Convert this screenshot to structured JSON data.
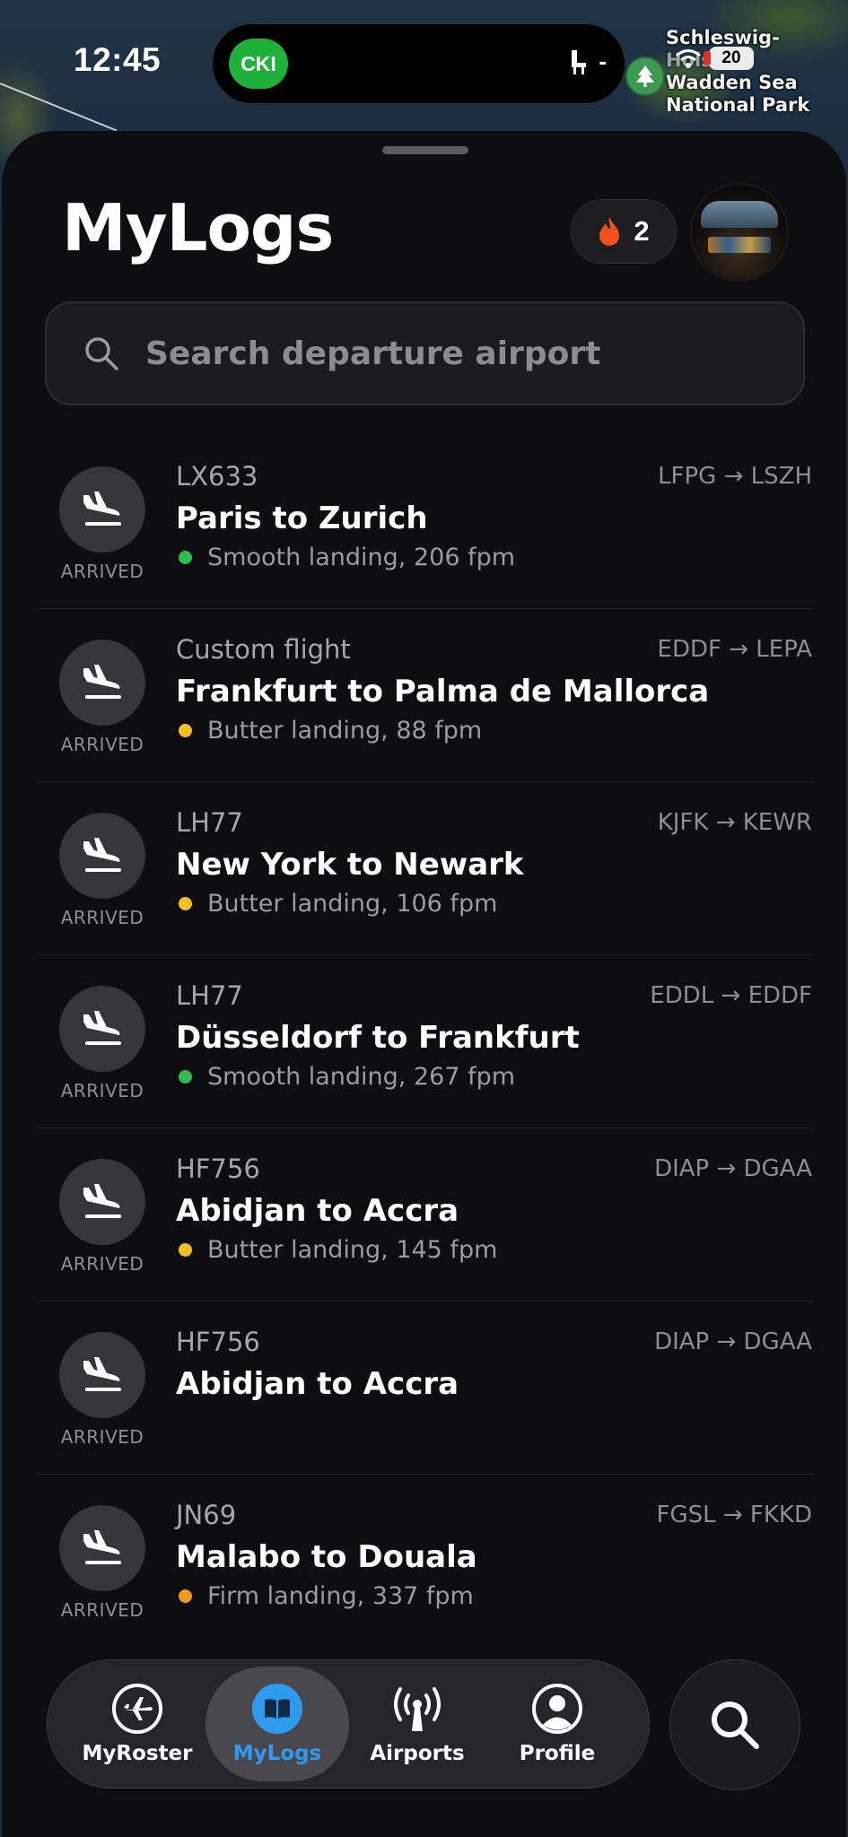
{
  "status_bar": {
    "time": "12:45",
    "activity_badge": "CKI",
    "activity_value": "-",
    "battery": "20",
    "battery_color": "#ececec"
  },
  "map": {
    "label_lines": [
      "Schleswig-",
      "Holstein",
      "Wadden Sea",
      "National Park"
    ]
  },
  "header": {
    "title": "MyLogs",
    "streak_count": "2",
    "streak_icon": "flame-icon",
    "avatar_icon": "cockpit-avatar"
  },
  "search": {
    "placeholder": "Search departure airport",
    "icon": "search-icon"
  },
  "colors": {
    "smooth": "#2fbe4f",
    "butter": "#f2c11f",
    "firm": "#ef9a1f",
    "accent": "#2e9bf0"
  },
  "flights": [
    {
      "code": "LX633",
      "route": "LFPG → LSZH",
      "title": "Paris to Zurich",
      "status": "ARRIVED",
      "landing": "Smooth landing, 206 fpm",
      "landing_type": "smooth"
    },
    {
      "code": "Custom flight",
      "route": "EDDF → LEPA",
      "title": "Frankfurt to Palma de Mallorca",
      "status": "ARRIVED",
      "landing": "Butter landing, 88 fpm",
      "landing_type": "butter"
    },
    {
      "code": "LH77",
      "route": "KJFK → KEWR",
      "title": "New York to Newark",
      "status": "ARRIVED",
      "landing": "Butter landing, 106 fpm",
      "landing_type": "butter"
    },
    {
      "code": "LH77",
      "route": "EDDL → EDDF",
      "title": "Düsseldorf to Frankfurt",
      "status": "ARRIVED",
      "landing": "Smooth landing, 267 fpm",
      "landing_type": "smooth"
    },
    {
      "code": "HF756",
      "route": "DIAP → DGAA",
      "title": "Abidjan to Accra",
      "status": "ARRIVED",
      "landing": "Butter landing, 145 fpm",
      "landing_type": "butter"
    },
    {
      "code": "HF756",
      "route": "DIAP → DGAA",
      "title": "Abidjan to Accra",
      "status": "ARRIVED",
      "landing": "",
      "landing_type": "none"
    },
    {
      "code": "JN69",
      "route": "FGSL → FKKD",
      "title": "Malabo to Douala",
      "status": "ARRIVED",
      "landing": "Firm landing, 337 fpm",
      "landing_type": "firm"
    }
  ],
  "tabbar": {
    "tabs": [
      {
        "label": "MyRoster",
        "icon": "plane-circle-icon",
        "active": false
      },
      {
        "label": "MyLogs",
        "icon": "book-icon",
        "active": true
      },
      {
        "label": "Airports",
        "icon": "antenna-icon",
        "active": false
      },
      {
        "label": "Profile",
        "icon": "profile-icon",
        "active": false
      }
    ],
    "search_button_icon": "search-icon"
  }
}
